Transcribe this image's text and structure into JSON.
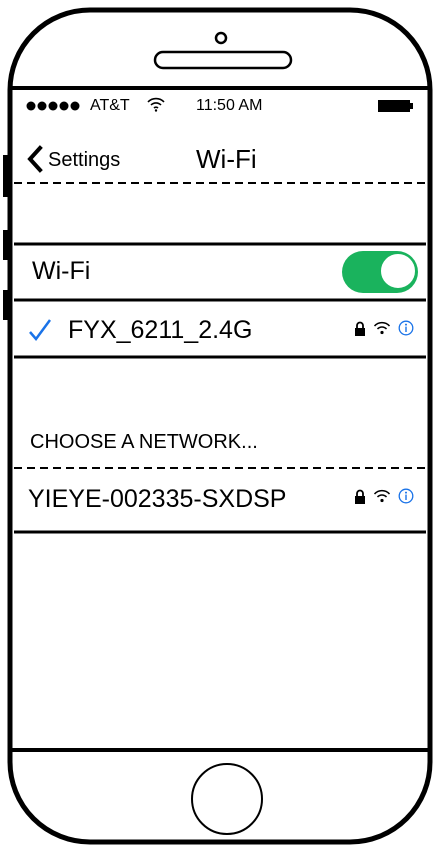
{
  "status_bar": {
    "carrier": "AT&T",
    "time": "11:50 AM",
    "signal_icon": "signal-dots-icon",
    "wifi_icon": "wifi-icon",
    "battery_icon": "battery-icon"
  },
  "nav": {
    "back_label": "Settings",
    "title": "Wi-Fi"
  },
  "wifi_toggle": {
    "label": "Wi-Fi",
    "on": true,
    "color": "#1ab35d"
  },
  "connected_network": {
    "name": "FYX_6211_2.4G",
    "check_color": "#1a73e8"
  },
  "networks_section": {
    "title": "CHOOSE A NETWORK..."
  },
  "networks": [
    {
      "name": "YIEYE-002335-SXDSP"
    }
  ],
  "accent_color": "#1a73e8"
}
